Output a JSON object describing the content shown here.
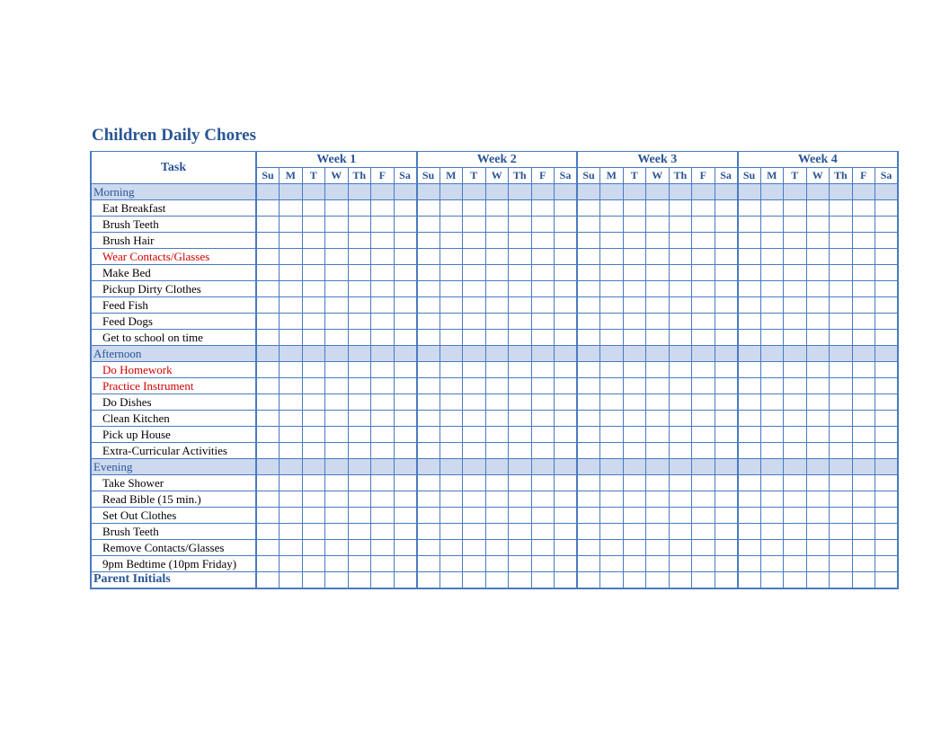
{
  "title": "Children Daily Chores",
  "task_header": "Task",
  "weeks": [
    "Week 1",
    "Week 2",
    "Week 3",
    "Week 4"
  ],
  "days": [
    "Su",
    "M",
    "T",
    "W",
    "Th",
    "F",
    "Sa"
  ],
  "sections": [
    {
      "name": "Morning",
      "tasks": [
        {
          "label": "Eat Breakfast",
          "red": false
        },
        {
          "label": "Brush Teeth",
          "red": false
        },
        {
          "label": "Brush Hair",
          "red": false
        },
        {
          "label": "Wear Contacts/Glasses",
          "red": true
        },
        {
          "label": "Make Bed",
          "red": false
        },
        {
          "label": "Pickup Dirty Clothes",
          "red": false
        },
        {
          "label": "Feed Fish",
          "red": false
        },
        {
          "label": "Feed Dogs",
          "red": false
        },
        {
          "label": "Get to school on time",
          "red": false
        }
      ]
    },
    {
      "name": "Afternoon",
      "tasks": [
        {
          "label": "Do Homework",
          "red": true
        },
        {
          "label": "Practice Instrument",
          "red": true
        },
        {
          "label": "Do Dishes",
          "red": false
        },
        {
          "label": "Clean Kitchen",
          "red": false
        },
        {
          "label": "Pick up House",
          "red": false
        },
        {
          "label": "Extra-Curricular Activities",
          "red": false
        }
      ]
    },
    {
      "name": "Evening",
      "tasks": [
        {
          "label": "Take Shower",
          "red": false
        },
        {
          "label": "Read Bible (15 min.)",
          "red": false
        },
        {
          "label": "Set Out Clothes",
          "red": false
        },
        {
          "label": "Brush Teeth",
          "red": false
        },
        {
          "label": "Remove Contacts/Glasses",
          "red": false
        },
        {
          "label": "9pm Bedtime (10pm Friday)",
          "red": false
        }
      ]
    }
  ],
  "footer": "Parent Initials"
}
